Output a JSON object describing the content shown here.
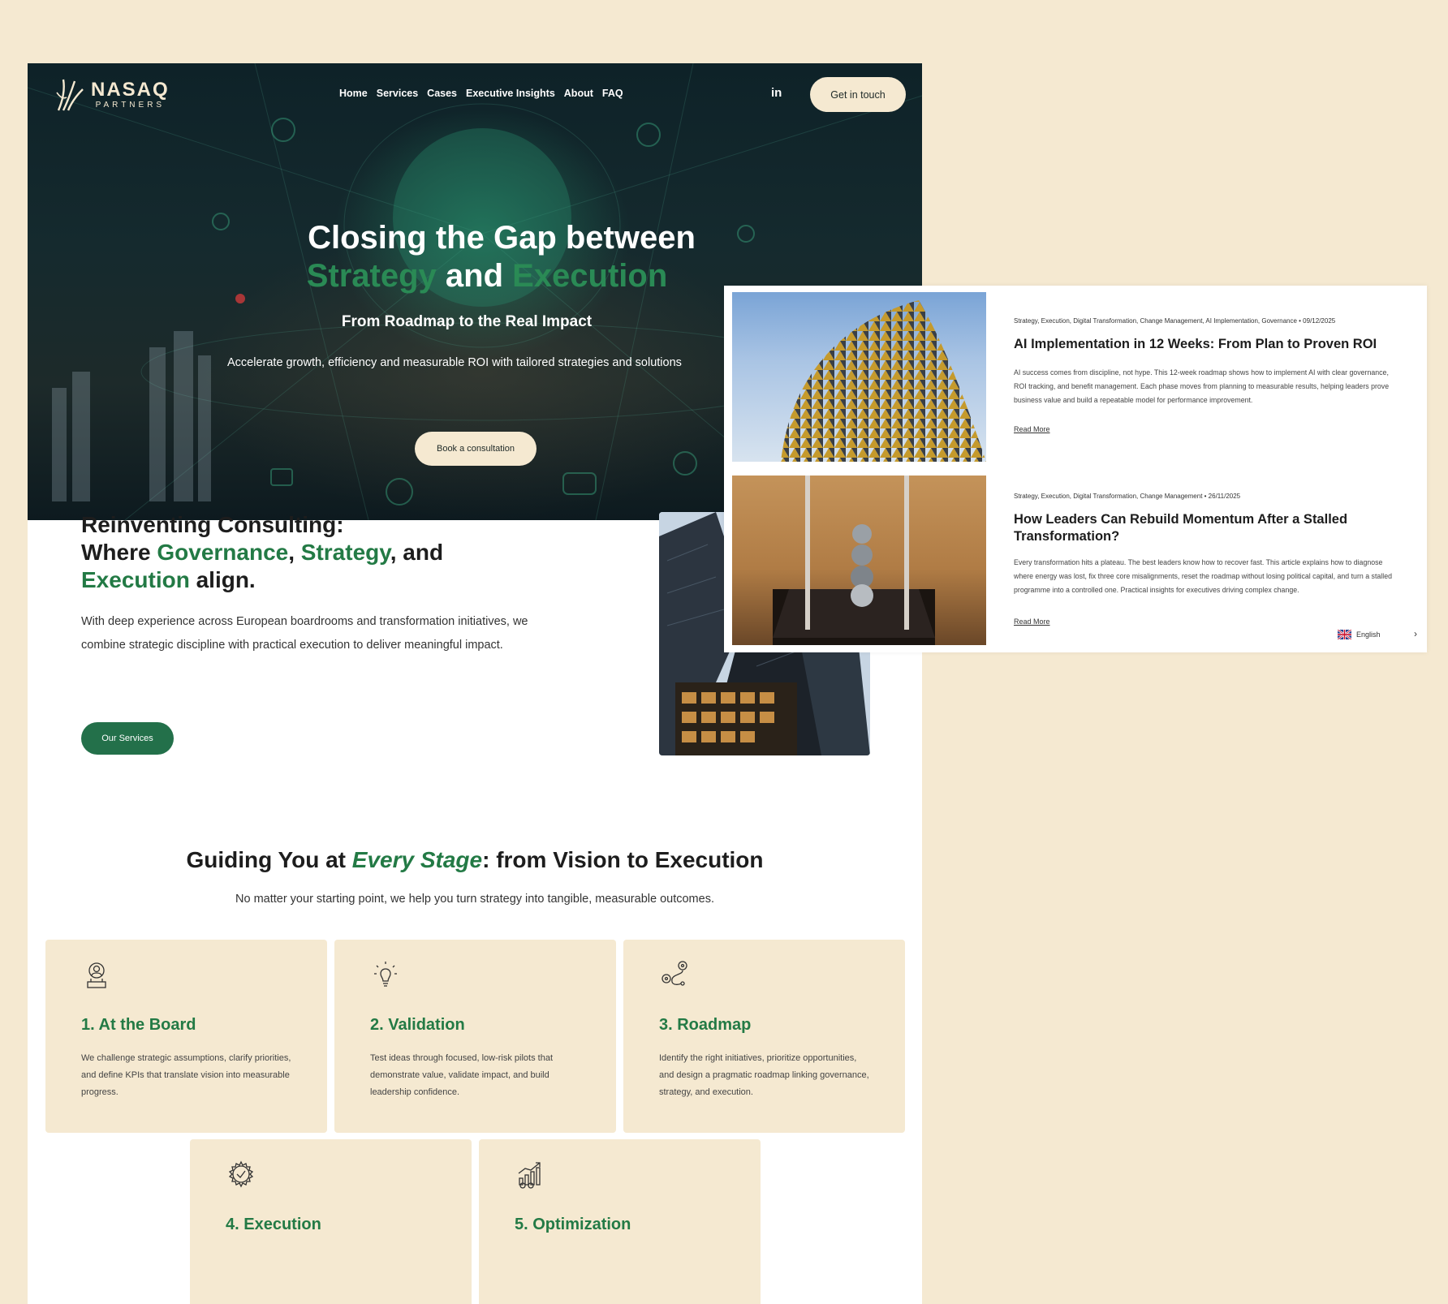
{
  "brand": {
    "name": "NASAQ",
    "sub": "PARTNERS"
  },
  "nav": {
    "links": [
      "Home",
      "Services",
      "Cases",
      "Executive Insights",
      "About",
      "FAQ"
    ],
    "linkedin": "in",
    "cta": "Get in touch"
  },
  "hero": {
    "line1": "Closing the Gap between",
    "line2_a": "Strategy",
    "line2_b": " and ",
    "line2_c": "Execution",
    "subtitle": "From Roadmap to the Real Impact",
    "description": "Accelerate growth, efficiency and measurable ROI with tailored strategies and solutions",
    "button": "Book a consultation"
  },
  "about": {
    "title_1": "Reinventing Consulting:",
    "title_2a": "Where ",
    "title_2b": "Governance",
    "title_2c": ", ",
    "title_2d": "Strategy",
    "title_2e": ", and",
    "title_3a": "Execution",
    "title_3b": " align.",
    "description": "With deep experience across European boardrooms and transformation initiatives, we combine strategic discipline with practical execution to deliver meaningful impact.",
    "button": "Our Services"
  },
  "guide": {
    "title_a": "Guiding You at ",
    "title_b": "Every Stage",
    "title_c": ": from Vision to Execution",
    "subtitle": "No matter your starting point, we help you turn strategy into tangible, measurable outcomes.",
    "cards": [
      {
        "icon": "board-icon",
        "title": "1. At the Board",
        "text": "We challenge strategic assumptions, clarify priorities, and define KPIs that translate vision into measurable progress."
      },
      {
        "icon": "lightbulb-icon",
        "title": "2. Validation",
        "text": "Test ideas through focused, low-risk pilots that demonstrate value, validate impact, and build leadership confidence."
      },
      {
        "icon": "roadmap-icon",
        "title": "3. Roadmap",
        "text": "Identify the right initiatives, prioritize opportunities, and design a pragmatic roadmap linking governance, strategy, and execution."
      },
      {
        "icon": "gear-check-icon",
        "title": "4. Execution",
        "text": ""
      },
      {
        "icon": "growth-chart-icon",
        "title": "5. Optimization",
        "text": ""
      }
    ]
  },
  "articles": [
    {
      "meta": "Strategy, Execution, Digital Transformation, Change Management, AI Implementation, Governance  •  09/12/2025",
      "title": "AI Implementation in 12 Weeks: From Plan to Proven ROI",
      "excerpt": "AI success comes from discipline, not hype. This 12-week roadmap shows how to implement AI with clear governance, ROI tracking, and benefit management. Each phase moves from planning to measurable results, helping leaders prove business value and build a repeatable model for performance improvement.",
      "read_more": "Read More"
    },
    {
      "meta": "Strategy, Execution, Digital Transformation, Change Management  •  26/11/2025",
      "title": "How Leaders Can Rebuild Momentum After a Stalled Transformation?",
      "excerpt": "Every transformation hits a plateau. The best leaders know how to recover fast. This article explains how to diagnose where energy was lost, fix three core misalignments, reset the roadmap without losing political capital, and turn a stalled programme into a controlled one. Practical insights for executives driving complex change.",
      "read_more": "Read More"
    }
  ],
  "language": {
    "label": "English",
    "arrow": "›"
  },
  "colors": {
    "cream": "#f5e9d1",
    "green": "#237a45",
    "hero_green": "#2a8a55"
  }
}
